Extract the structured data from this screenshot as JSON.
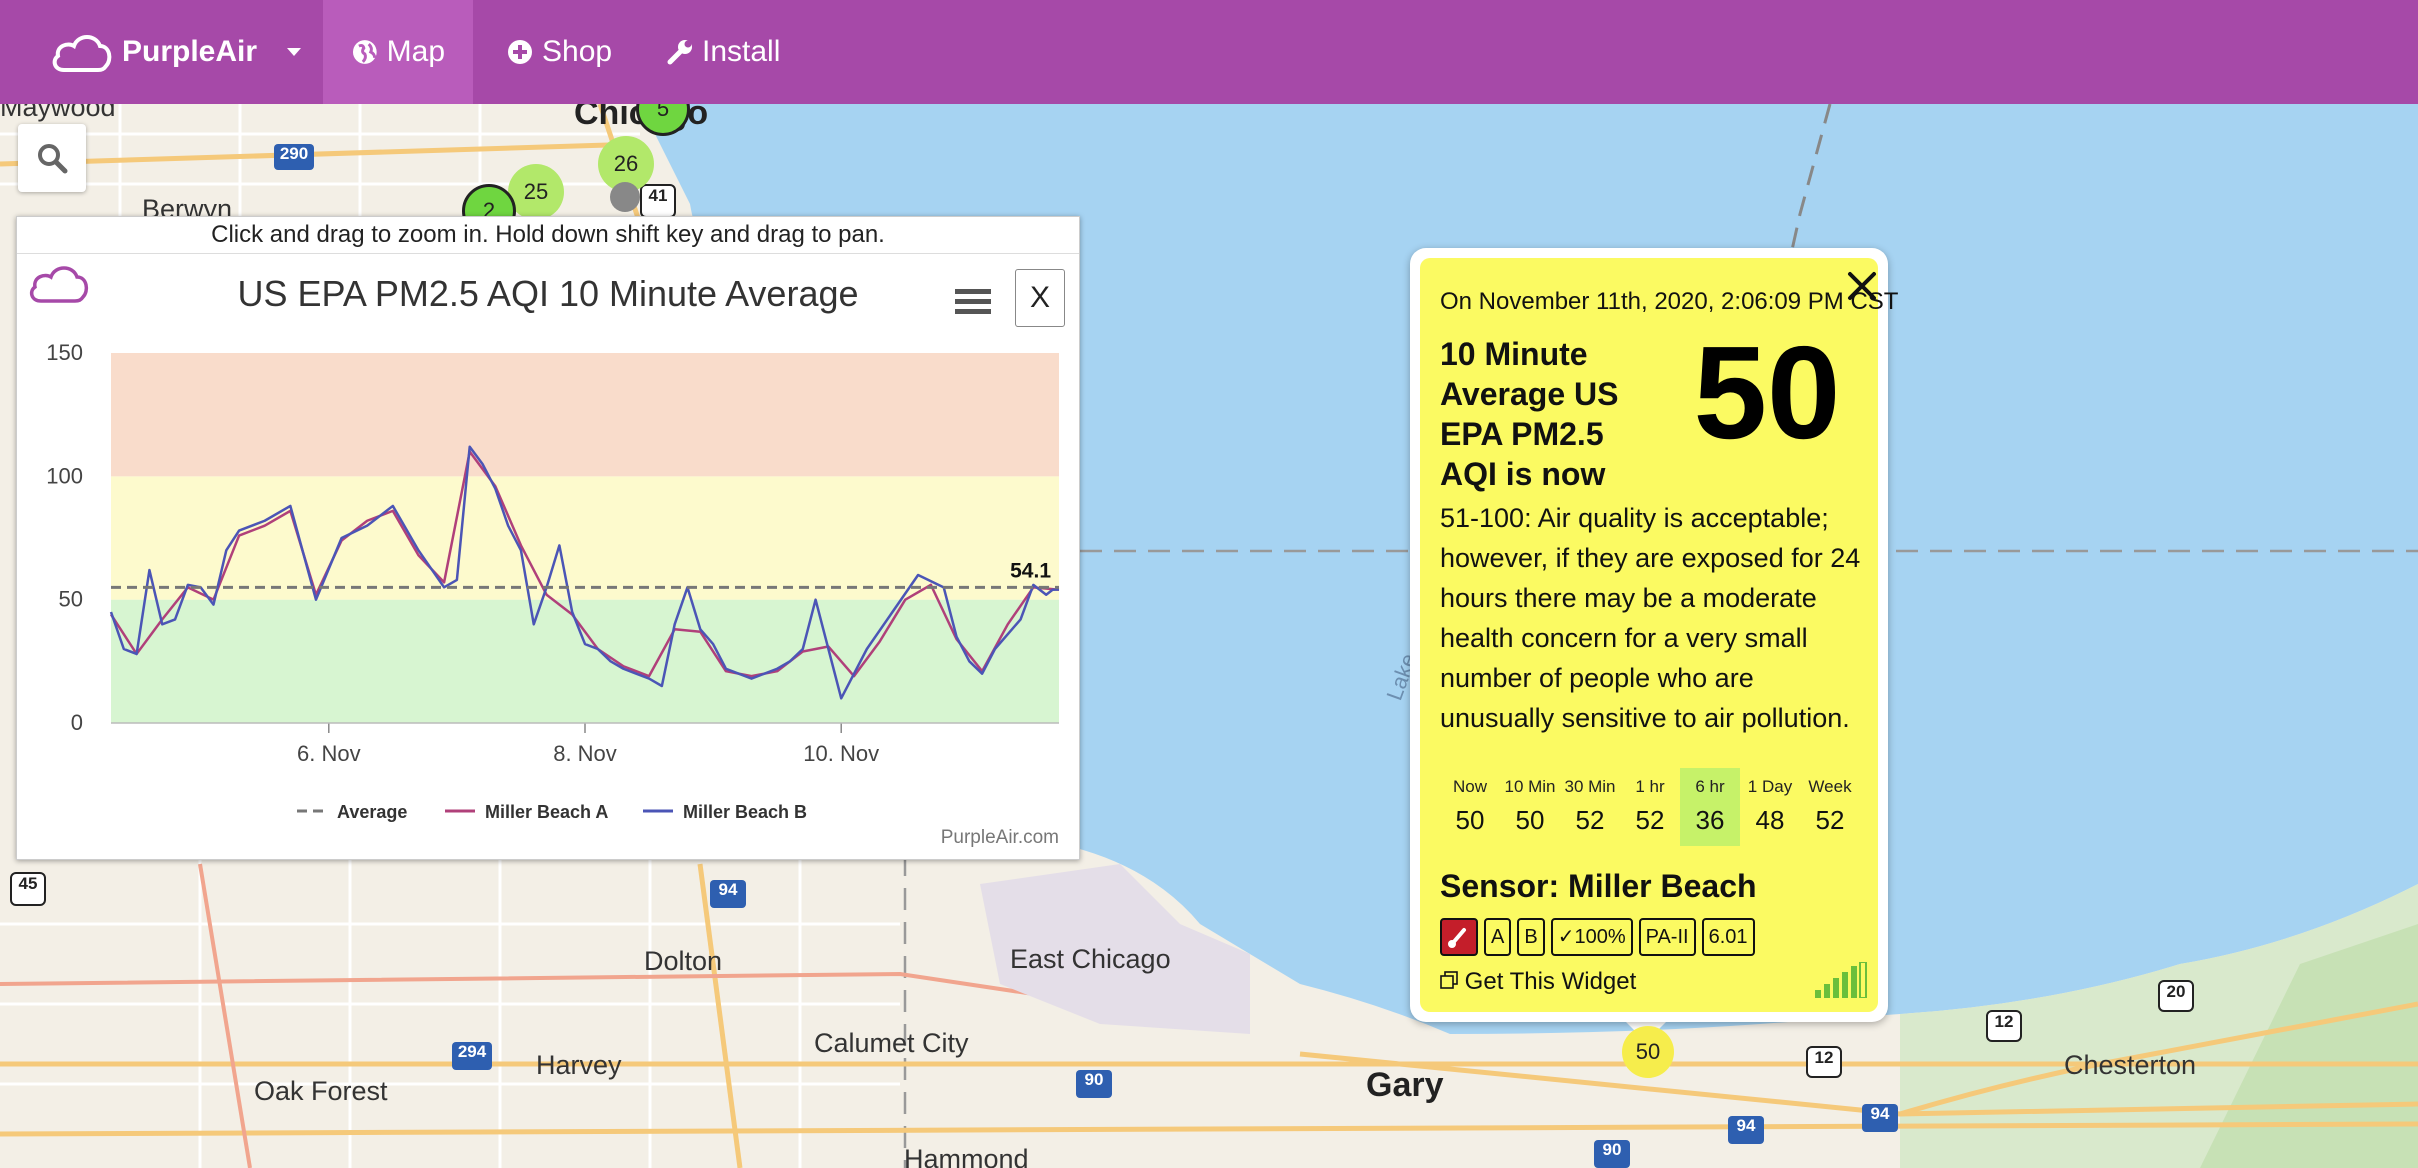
{
  "navbar": {
    "brand": "PurpleAir",
    "items": [
      {
        "label": "Map",
        "icon": "globe-icon"
      },
      {
        "label": "Shop",
        "icon": "plus-circle-icon"
      },
      {
        "label": "Install",
        "icon": "wrench-icon"
      }
    ]
  },
  "map": {
    "places": [
      "Maywood",
      "Berwyn",
      "Chicago",
      "Dolton",
      "East Chicago",
      "Calumet City",
      "Harvey",
      "Oak Forest",
      "Hammond",
      "Gary",
      "Chesterton",
      "Lake"
    ],
    "shields": [
      "290",
      "41",
      "45",
      "94",
      "294",
      "90",
      "12",
      "20",
      "94",
      "90",
      "94",
      "12"
    ],
    "clusters": [
      {
        "label": "5",
        "color": "#6fd640"
      },
      {
        "label": "26",
        "color": "#b2e86a"
      },
      {
        "label": "25",
        "color": "#b2e86a"
      },
      {
        "label": "2",
        "color": "#6fd640"
      }
    ],
    "sensor_marker": "50"
  },
  "chart_panel": {
    "hint": "Click and drag to zoom in. Hold down shift key and drag to pan.",
    "close_label": "X",
    "credit": "PurpleAir.com",
    "latest_label": "54.1"
  },
  "chart_data": {
    "type": "line",
    "title": "US EPA PM2.5 AQI 10 Minute Average",
    "xlabel": "",
    "ylabel": "",
    "ylim": [
      0,
      150
    ],
    "yticks": [
      0,
      50,
      100,
      150
    ],
    "xticks": [
      "6. Nov",
      "8. Nov",
      "10. Nov"
    ],
    "bands": [
      {
        "from": 0,
        "to": 50,
        "color": "#d7f5d1"
      },
      {
        "from": 50,
        "to": 100,
        "color": "#fdfacd"
      },
      {
        "from": 100,
        "to": 150,
        "color": "#f9dccb"
      }
    ],
    "average": 55,
    "legend": [
      "Average",
      "Miller Beach A",
      "Miller Beach B"
    ],
    "x_start_day": 4.3,
    "x_end_day": 11.7,
    "series": [
      {
        "name": "Miller Beach B",
        "color": "#4b55b6",
        "x": [
          4.3,
          4.4,
          4.5,
          4.6,
          4.7,
          4.8,
          4.9,
          5.0,
          5.1,
          5.2,
          5.3,
          5.5,
          5.7,
          5.9,
          6.1,
          6.3,
          6.5,
          6.7,
          6.9,
          7.0,
          7.1,
          7.2,
          7.3,
          7.4,
          7.5,
          7.6,
          7.7,
          7.8,
          7.9,
          8.0,
          8.1,
          8.2,
          8.3,
          8.4,
          8.5,
          8.6,
          8.7,
          8.8,
          8.9,
          9.0,
          9.1,
          9.2,
          9.3,
          9.4,
          9.5,
          9.6,
          9.7,
          9.8,
          9.9,
          10.0,
          10.1,
          10.2,
          10.4,
          10.6,
          10.8,
          10.9,
          11.0,
          11.1,
          11.2,
          11.4,
          11.5,
          11.6,
          11.65,
          11.7
        ],
        "y": [
          45,
          30,
          28,
          62,
          40,
          42,
          56,
          55,
          48,
          70,
          78,
          82,
          88,
          50,
          75,
          80,
          88,
          70,
          55,
          58,
          112,
          105,
          95,
          80,
          70,
          40,
          55,
          72,
          45,
          32,
          30,
          25,
          22,
          20,
          18,
          15,
          40,
          55,
          38,
          32,
          22,
          20,
          18,
          20,
          22,
          25,
          30,
          50,
          30,
          10,
          20,
          30,
          45,
          60,
          55,
          35,
          25,
          20,
          30,
          42,
          56,
          52,
          54,
          54.1
        ]
      },
      {
        "name": "Miller Beach A",
        "color": "#b0407a",
        "x": [
          4.3,
          4.5,
          4.7,
          4.9,
          5.1,
          5.3,
          5.5,
          5.7,
          5.9,
          6.1,
          6.3,
          6.5,
          6.7,
          6.9,
          7.1,
          7.3,
          7.5,
          7.7,
          7.9,
          8.1,
          8.3,
          8.5,
          8.7,
          8.9,
          9.1,
          9.3,
          9.5,
          9.7,
          9.9,
          10.1,
          10.3,
          10.5,
          10.7,
          10.9,
          11.1,
          11.3,
          11.5,
          11.7
        ],
        "y": [
          44,
          28,
          42,
          55,
          50,
          76,
          80,
          86,
          52,
          74,
          82,
          86,
          68,
          57,
          110,
          96,
          72,
          52,
          44,
          30,
          23,
          19,
          38,
          37,
          21,
          19,
          21,
          29,
          31,
          19,
          33,
          50,
          56,
          34,
          21,
          40,
          55,
          54
        ]
      }
    ]
  },
  "popup": {
    "date": "On November 11th, 2020, 2:06:09 PM CST",
    "label": "10 Minute Average US EPA PM2.5 AQI is now",
    "value": "50",
    "description": "51-100: Air quality is acceptable; however, if they are exposed for 24 hours there may be a moderate health concern for a very small number of people who are unusually sensitive to air pollution.",
    "stats": [
      {
        "label": "Now",
        "value": "50"
      },
      {
        "label": "10 Min",
        "value": "50"
      },
      {
        "label": "30 Min",
        "value": "52"
      },
      {
        "label": "1 hr",
        "value": "52"
      },
      {
        "label": "6 hr",
        "value": "36"
      },
      {
        "label": "1 Day",
        "value": "48"
      },
      {
        "label": "Week",
        "value": "52"
      }
    ],
    "sensor": "Sensor: Miller Beach",
    "badges": [
      "A",
      "B",
      "✓100%",
      "PA-II",
      "6.01"
    ],
    "widget": "Get This Widget"
  }
}
